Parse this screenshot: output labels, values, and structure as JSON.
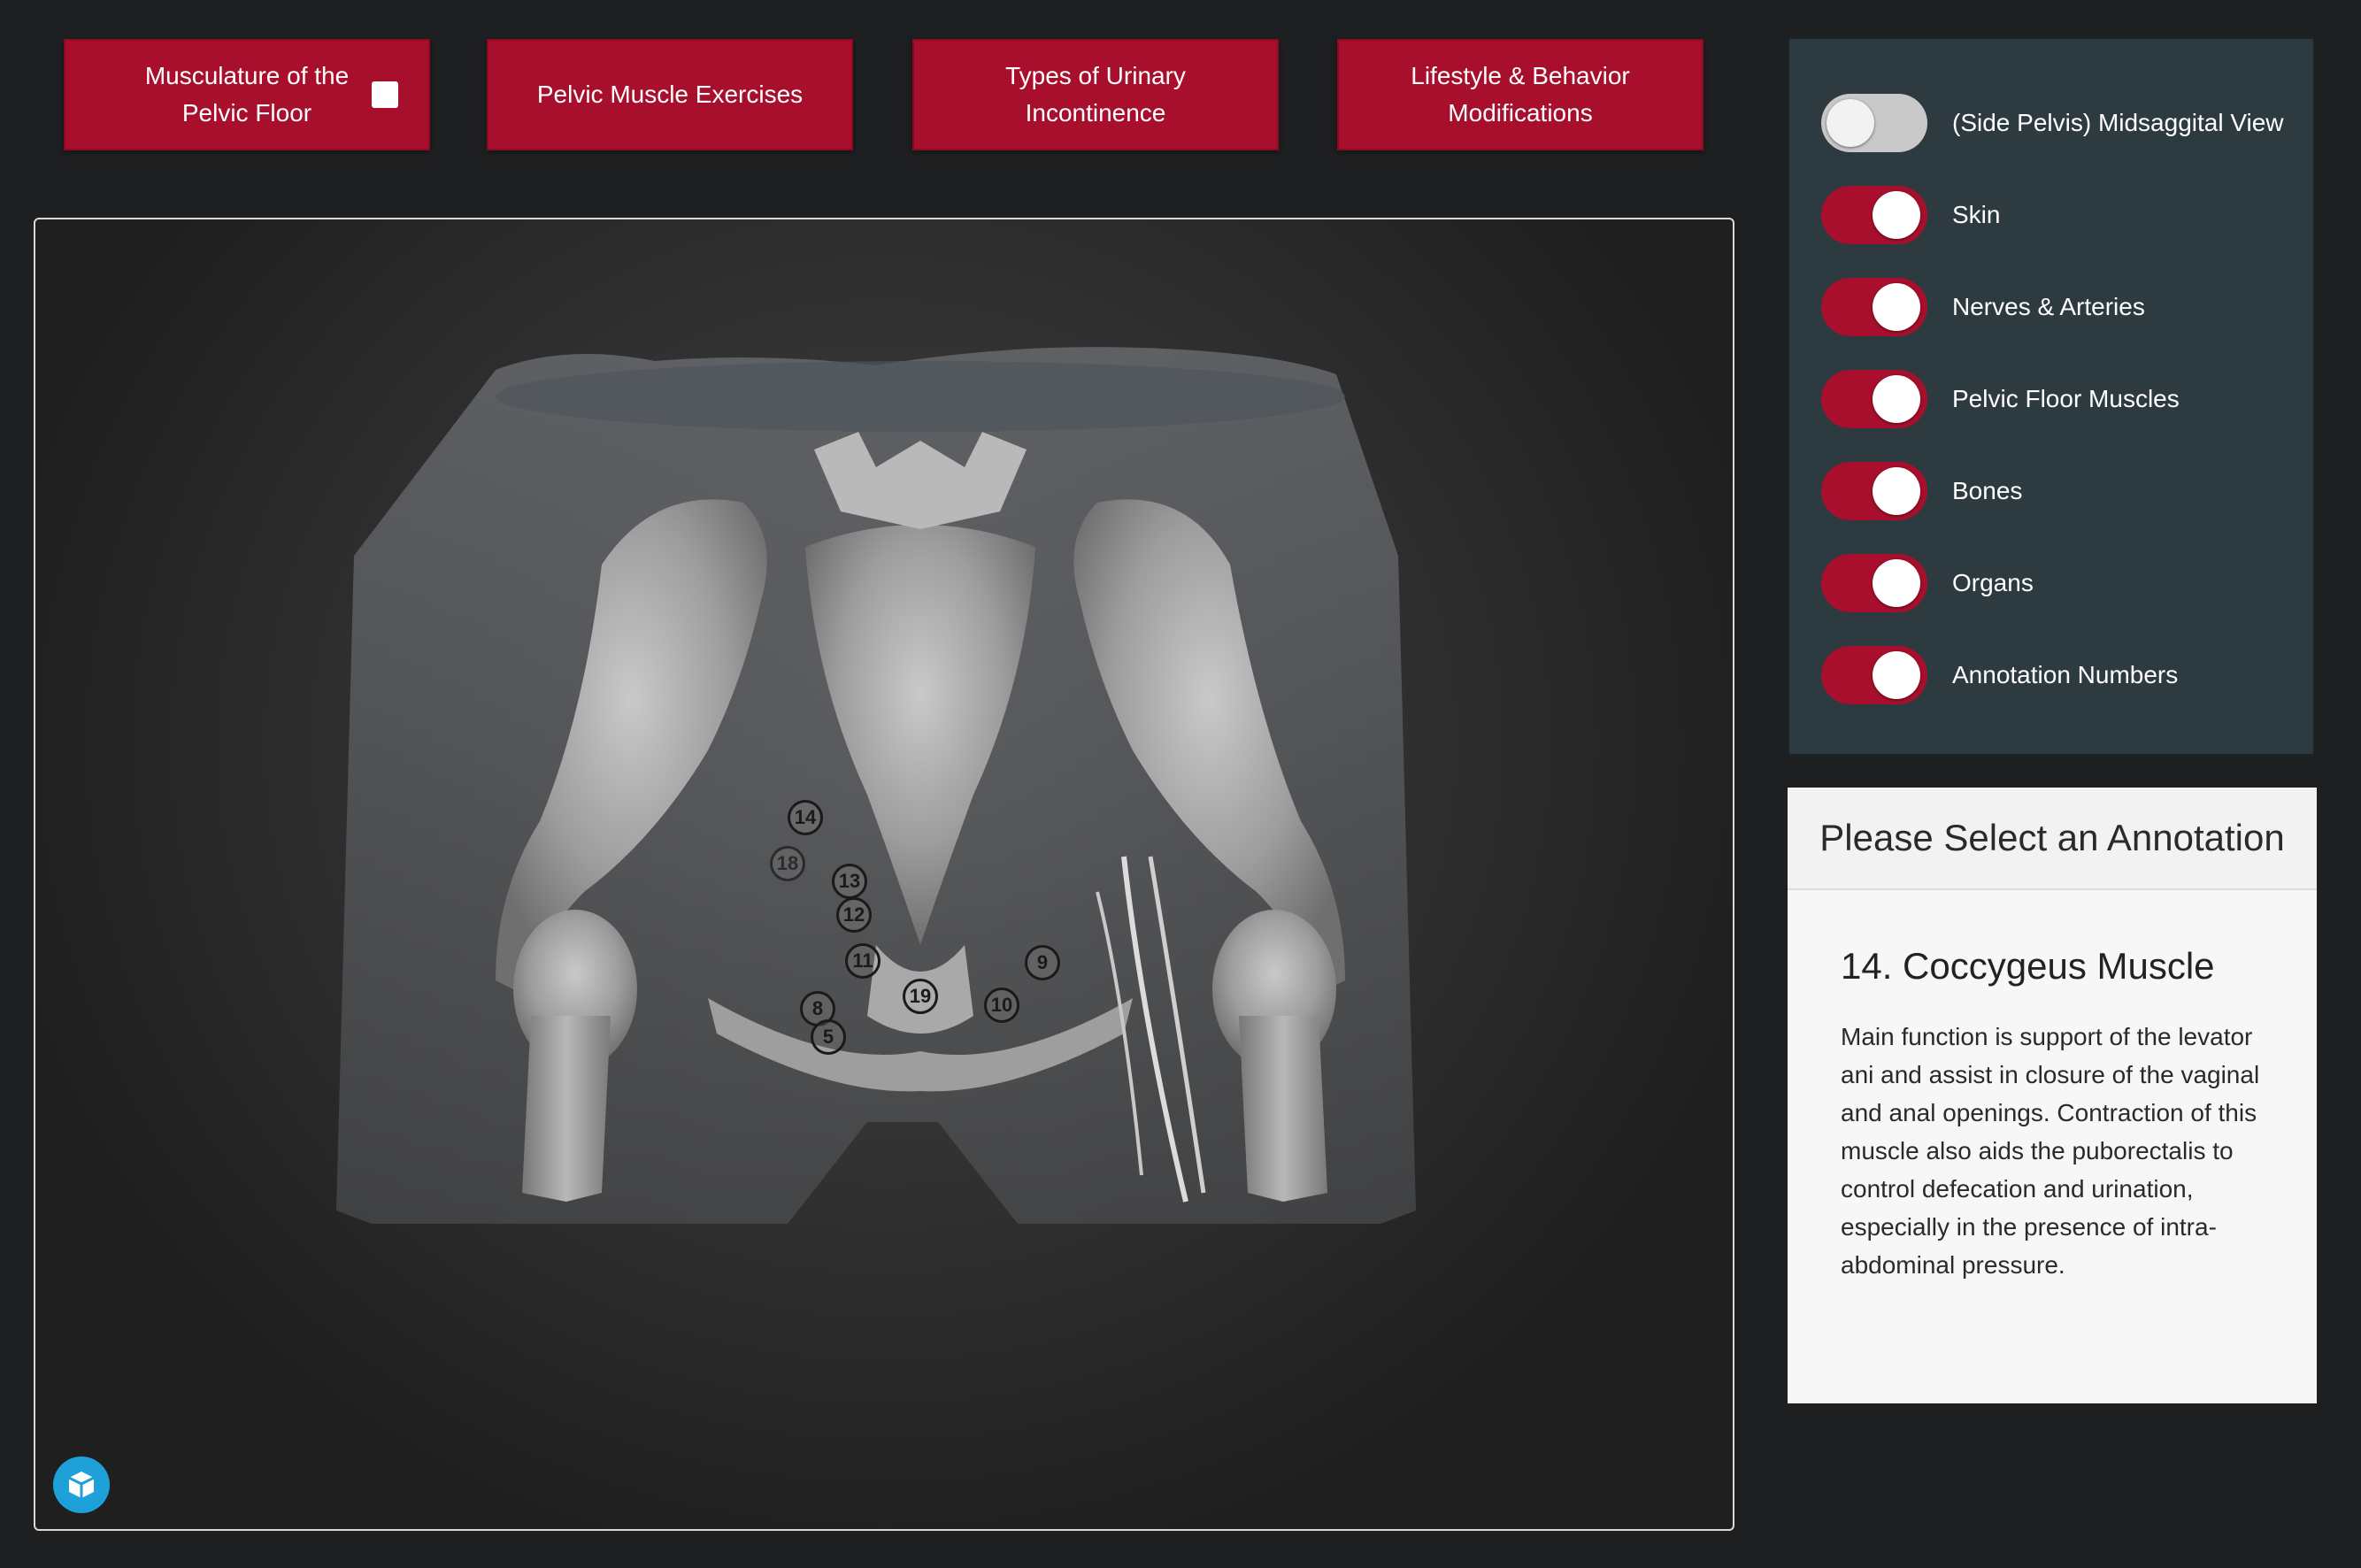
{
  "nav": {
    "buttons": [
      {
        "label": "Musculature of the Pelvic Floor",
        "checkbox": true
      },
      {
        "label": "Pelvic Muscle Exercises"
      },
      {
        "label": "Types of Urinary Incontinence"
      },
      {
        "label": "Lifestyle & Behavior Modifications"
      }
    ]
  },
  "layers": [
    {
      "label": "(Side Pelvis) Midsaggital View",
      "on": false
    },
    {
      "label": "Skin",
      "on": true
    },
    {
      "label": "Nerves & Arteries",
      "on": true
    },
    {
      "label": "Pelvic Floor Muscles",
      "on": true
    },
    {
      "label": "Bones",
      "on": true
    },
    {
      "label": "Organs",
      "on": true
    },
    {
      "label": "Annotation Numbers",
      "on": true
    }
  ],
  "annotations": [
    "14",
    "13",
    "12",
    "11",
    "9",
    "19",
    "10",
    "8",
    "5",
    "18"
  ],
  "info": {
    "header": "Please Select an Annotation",
    "title": "14. Coccygeus Muscle",
    "body": "Main function is support of the levator ani and assist in closure of the vaginal and anal openings. Contraction of this muscle also aids the puborectalis to control defecation and urination, especially in the presence of intra-abdominal pressure."
  },
  "colors": {
    "accent": "#a80f2c",
    "panel": "#2d3a40",
    "background": "#1e1f20"
  }
}
